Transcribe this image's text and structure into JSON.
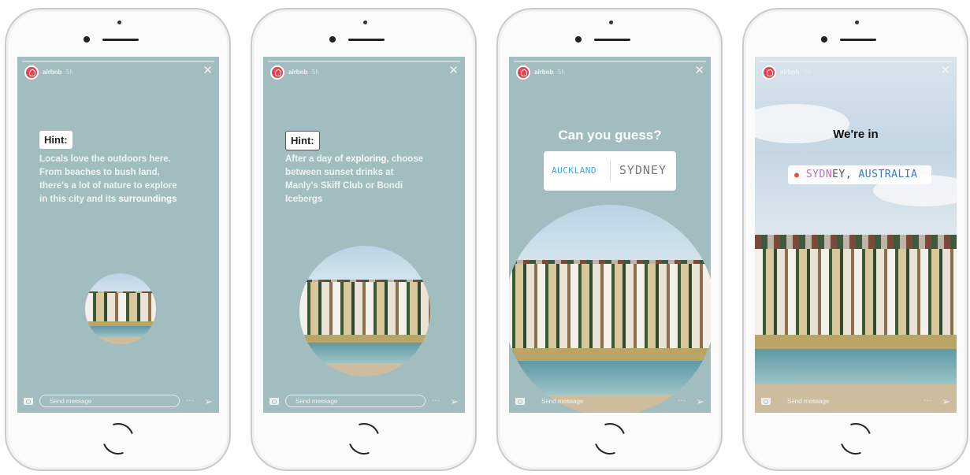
{
  "story": {
    "username": "airbnb",
    "time": "5h",
    "send_placeholder": "Send message",
    "more_icon": "ellipsis-icon",
    "dm_icon": "send-icon"
  },
  "screens": [
    {
      "hint_label": "Hint:",
      "hint_text_parts": [
        "Locals love the outdoors here. From beaches to bush land, there's a lot of nature to explore in this city and its ",
        "surroundings"
      ]
    },
    {
      "hint_label": "Hint:",
      "hint_text_parts": [
        "After a day of ",
        "exploring",
        ", choose between sunset drinks at Manly's Skiff Club or Bondi Icebergs"
      ]
    },
    {
      "title": "Can you guess?",
      "poll": {
        "option_a": "AUCKLAND",
        "option_b": "SYDNEY"
      }
    },
    {
      "title": "We're in",
      "location": {
        "part1": "SYDN",
        "part2": "EY, ",
        "part3": "AUSTRALIA"
      }
    }
  ],
  "colors": {
    "story_bg": "#a2bdbf",
    "avatar": "#e8434f",
    "auckland": "#3fa7d8",
    "location_pin": "#e0553d"
  }
}
